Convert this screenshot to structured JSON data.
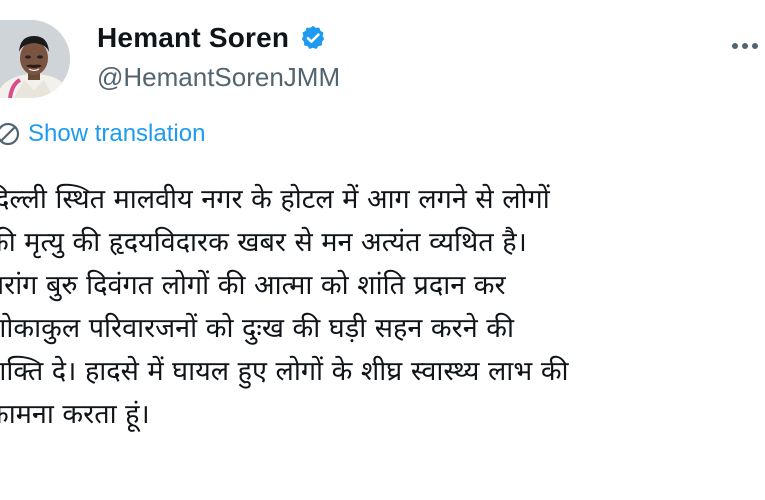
{
  "tweet": {
    "author": {
      "display_name": "Hemant Soren",
      "handle": "@HemantSorenJMM",
      "verified": true,
      "avatar_icon": "profile-photo"
    },
    "translate_label": "Show translation",
    "body_lines": [
      "दिल्ली स्थित मालवीय नगर के होटल में आग लगने से लोगों",
      "की मृत्यु की हृदयविदारक खबर से मन अत्यंत व्यथित है।",
      "मरांग बुरु दिवंगत लोगों की आत्मा को शांति प्रदान कर",
      "शोकाकुल परिवारजनों को दुःख की घड़ी सहन करने की",
      "शक्ति दे। हादसे में घायल हुए लोगों के शीघ्र स्वास्थ्य लाभ की",
      "कामना करता हूं।"
    ]
  },
  "colors": {
    "link_blue": "#1d9bf0",
    "verified_blue": "#1d9bf0",
    "text_primary": "#0f1419",
    "text_secondary": "#536471"
  }
}
